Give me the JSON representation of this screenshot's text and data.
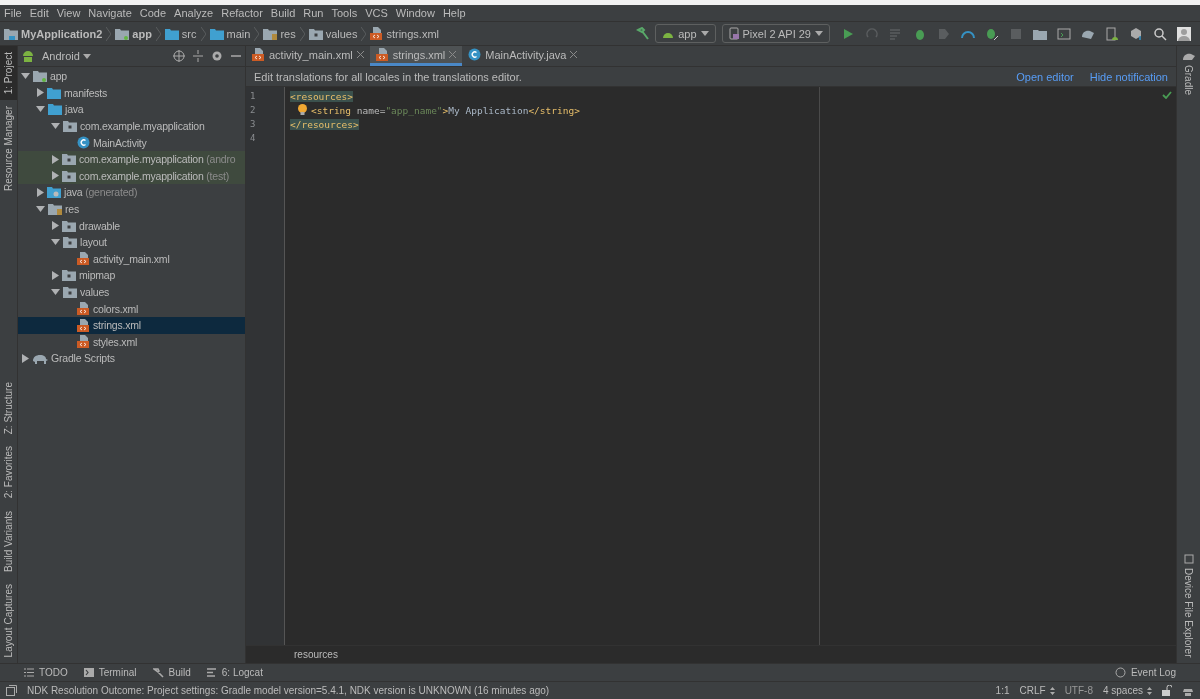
{
  "menu": [
    "File",
    "Edit",
    "View",
    "Navigate",
    "Code",
    "Analyze",
    "Refactor",
    "Build",
    "Run",
    "Tools",
    "VCS",
    "Window",
    "Help"
  ],
  "breadcrumbs": [
    {
      "label": "MyApplication2",
      "kind": "project"
    },
    {
      "label": "app",
      "kind": "module"
    },
    {
      "label": "src",
      "kind": "folder"
    },
    {
      "label": "main",
      "kind": "folder"
    },
    {
      "label": "res",
      "kind": "res"
    },
    {
      "label": "values",
      "kind": "package"
    },
    {
      "label": "strings.xml",
      "kind": "xml"
    }
  ],
  "run_toolbar": {
    "configuration": "app",
    "device": "Pixel 2 API 29"
  },
  "left_tool_windows": [
    {
      "label": "1: Project",
      "selected": true
    },
    {
      "label": "Resource Manager",
      "selected": false
    },
    {
      "label": "Z: Structure",
      "selected": false
    },
    {
      "label": "2: Favorites",
      "selected": false
    },
    {
      "label": "Build Variants",
      "selected": false
    },
    {
      "label": "Layout Captures",
      "selected": false
    }
  ],
  "project_panel": {
    "view": "Android",
    "tree": [
      {
        "label": "app",
        "kind": "module",
        "expanded": true,
        "selected": false,
        "children": [
          {
            "label": "manifests",
            "kind": "folder",
            "expanded": false,
            "selected": false
          },
          {
            "label": "java",
            "kind": "folder",
            "expanded": true,
            "selected": false,
            "children": [
              {
                "label": "com.example.myapplication",
                "kind": "package",
                "expanded": true,
                "selected": false,
                "children": [
                  {
                    "label": "MainActivity",
                    "kind": "class",
                    "selected": false
                  }
                ]
              },
              {
                "label": "com.example.myapplication",
                "suffix": "(andro",
                "kind": "test-package",
                "expanded": false,
                "selected": false
              },
              {
                "label": "com.example.myapplication",
                "suffix": "(test)",
                "kind": "test-package",
                "expanded": false,
                "selected": false
              }
            ]
          },
          {
            "label": "java",
            "suffix": "(generated)",
            "kind": "generated",
            "expanded": false,
            "selected": false
          },
          {
            "label": "res",
            "kind": "res",
            "expanded": true,
            "selected": false,
            "children": [
              {
                "label": "drawable",
                "kind": "package",
                "expanded": false,
                "selected": false
              },
              {
                "label": "layout",
                "kind": "package",
                "expanded": true,
                "selected": false,
                "children": [
                  {
                    "label": "activity_main.xml",
                    "kind": "xml",
                    "selected": false
                  }
                ]
              },
              {
                "label": "mipmap",
                "kind": "package",
                "expanded": false,
                "selected": false
              },
              {
                "label": "values",
                "kind": "package",
                "expanded": true,
                "selected": false,
                "children": [
                  {
                    "label": "colors.xml",
                    "kind": "xml",
                    "selected": false
                  },
                  {
                    "label": "strings.xml",
                    "kind": "xml",
                    "selected": true
                  },
                  {
                    "label": "styles.xml",
                    "kind": "xml",
                    "selected": false
                  }
                ]
              }
            ]
          }
        ]
      },
      {
        "label": "Gradle Scripts",
        "kind": "gradle",
        "expanded": false,
        "selected": false
      }
    ]
  },
  "tabs": [
    {
      "label": "activity_main.xml",
      "kind": "xml",
      "selected": false
    },
    {
      "label": "strings.xml",
      "kind": "xml",
      "selected": true
    },
    {
      "label": "MainActivity.java",
      "kind": "class",
      "selected": false
    }
  ],
  "notification": {
    "text": "Edit translations for all locales in the translations editor.",
    "actions": [
      "Open editor",
      "Hide notification"
    ]
  },
  "code_lines": [
    {
      "number": "1",
      "intention": false,
      "tokens": [
        {
          "kind": "matched-tag",
          "text": "<resources>"
        }
      ]
    },
    {
      "number": "2",
      "intention": true,
      "tokens": [
        {
          "kind": "tag",
          "text": "<string"
        },
        {
          "kind": "attr",
          "text": " name="
        },
        {
          "kind": "value",
          "text": "\"app_name\""
        },
        {
          "kind": "tag",
          "text": ">"
        },
        {
          "kind": "text",
          "text": "My Application"
        },
        {
          "kind": "tag",
          "text": "</string>"
        }
      ]
    },
    {
      "number": "3",
      "intention": false,
      "tokens": [
        {
          "kind": "matched-tag",
          "text": "</resources>"
        }
      ]
    },
    {
      "number": "4",
      "intention": false
    }
  ],
  "editor_breadcrumb": "resources",
  "right_tool_windows": [
    {
      "label": "Gradle",
      "kind": "gradle"
    },
    {
      "label": "Device File Explorer",
      "kind": "device"
    }
  ],
  "bottom_tools": [
    {
      "label": "TODO",
      "kind": "todo"
    },
    {
      "label": "Terminal",
      "kind": "terminal"
    },
    {
      "label": "Build",
      "kind": "build"
    },
    {
      "label": "6: Logcat",
      "kind": "logcat"
    }
  ],
  "event_log": "Event Log",
  "status": {
    "message": "NDK Resolution Outcome: Project settings: Gradle model version=5.4.1, NDK version is UNKNOWN (16 minutes ago)",
    "position": "1:1",
    "line_separator": "CRLF",
    "encoding": "UTF-8",
    "indent": "4 spaces"
  }
}
